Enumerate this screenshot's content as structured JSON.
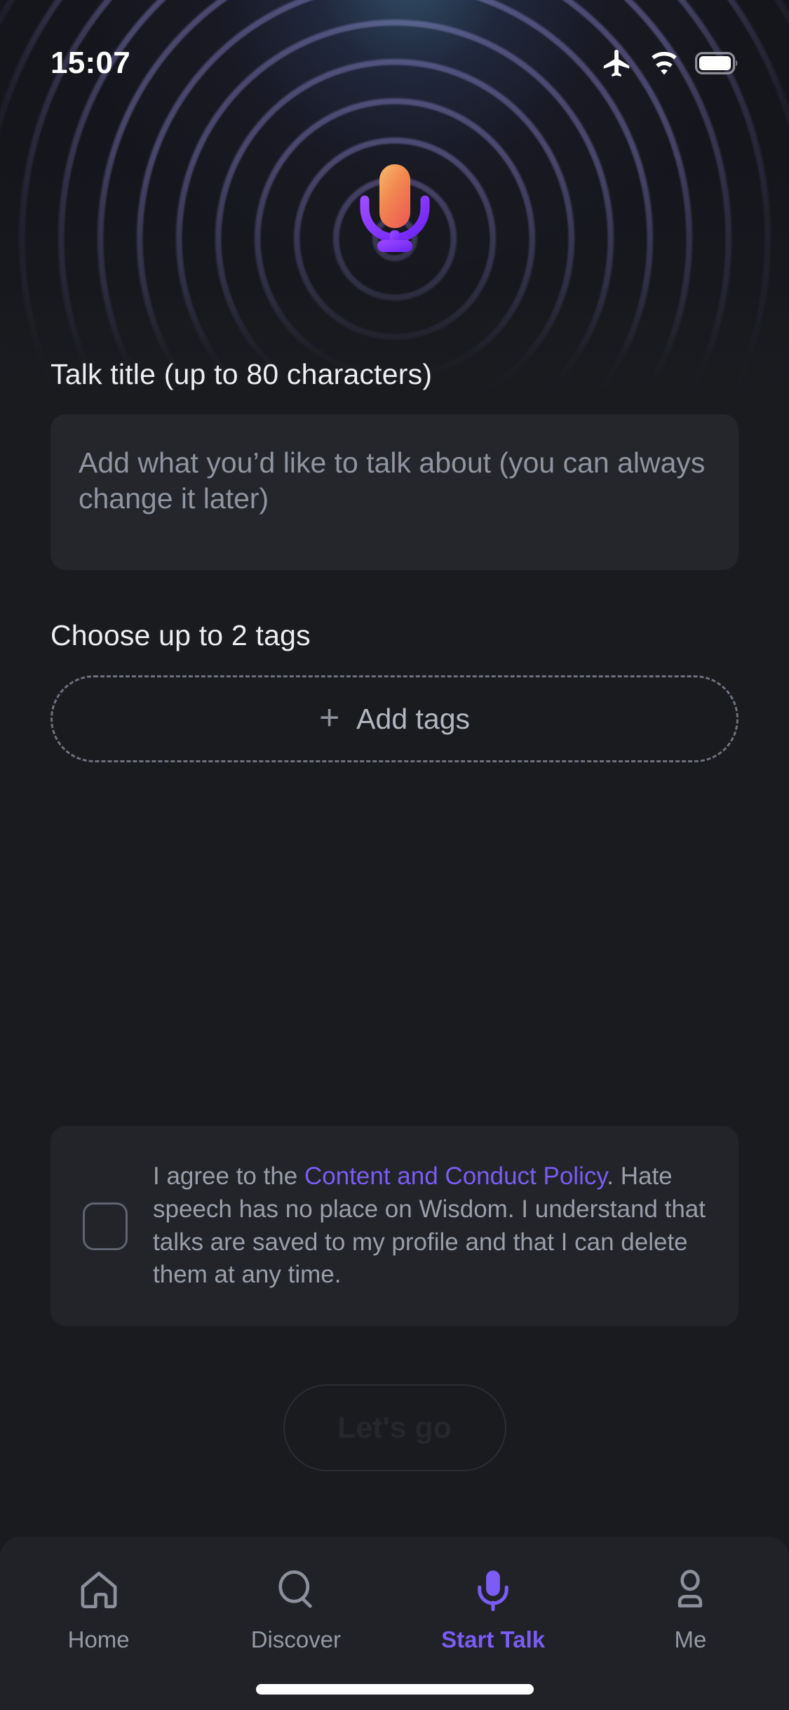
{
  "status_bar": {
    "time": "15:07",
    "icons": [
      "airplane-mode-icon",
      "wifi-icon",
      "battery-icon"
    ],
    "battery_level_percent": 92
  },
  "header": {
    "logo": "microphone-logo",
    "logo_colors": {
      "capsule_top": "#f3a85a",
      "capsule_bottom": "#ef5f53",
      "stand": "#7b2ff7"
    },
    "background": "concentric-sound-wave-rings"
  },
  "main": {
    "title_section": {
      "label": "Talk title (up to 80 characters)",
      "input_value": "",
      "input_placeholder": "Add what you’d like to talk about (you can always change it later)"
    },
    "tags_section": {
      "label": "Choose up to 2 tags",
      "add_button_label": "Add tags",
      "add_button_icon": "plus-icon",
      "selected_tags": []
    },
    "consent": {
      "checked": false,
      "text_before_link": "I agree to the ",
      "link_text": "Content and Conduct Policy",
      "text_after_link": ". Hate speech has no place on Wisdom. I understand that talks are saved to my profile and that I can delete them at any time."
    },
    "cta": {
      "label": "Let's go",
      "enabled": false
    }
  },
  "tab_bar": {
    "items": [
      {
        "label": "Home",
        "icon": "home-icon",
        "active": false
      },
      {
        "label": "Discover",
        "icon": "search-icon",
        "active": false
      },
      {
        "label": "Start Talk",
        "icon": "microphone-icon",
        "active": true
      },
      {
        "label": "Me",
        "icon": "person-icon",
        "active": false
      }
    ]
  },
  "colors": {
    "accent": "#7b5cf5",
    "page_background": "#191b1f",
    "surface": "#24262b",
    "tab_bar_background": "#202227",
    "muted_text": "#9a9ea9"
  }
}
